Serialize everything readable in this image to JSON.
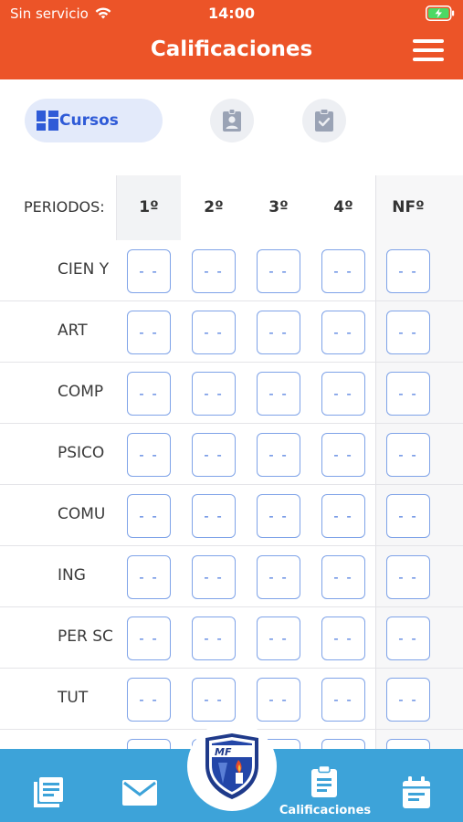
{
  "status_bar": {
    "carrier": "Sin servicio",
    "time": "14:00"
  },
  "header": {
    "title": "Calificaciones"
  },
  "segment": {
    "active_label": "Cursos"
  },
  "table": {
    "periods_label": "PERIODOS:",
    "periods": [
      "1º",
      "2º",
      "3º",
      "4º"
    ],
    "final_period": "NFº",
    "rows": [
      {
        "subject": "CIEN Y",
        "grades": [
          "- -",
          "- -",
          "- -",
          "- -"
        ],
        "final": "- -"
      },
      {
        "subject": "ART",
        "grades": [
          "- -",
          "- -",
          "- -",
          "- -"
        ],
        "final": "- -"
      },
      {
        "subject": "COMP",
        "grades": [
          "- -",
          "- -",
          "- -",
          "- -"
        ],
        "final": "- -"
      },
      {
        "subject": "PSICO",
        "grades": [
          "- -",
          "- -",
          "- -",
          "- -"
        ],
        "final": "- -"
      },
      {
        "subject": "COMU",
        "grades": [
          "- -",
          "- -",
          "- -",
          "- -"
        ],
        "final": "- -"
      },
      {
        "subject": "ING",
        "grades": [
          "- -",
          "- -",
          "- -",
          "- -"
        ],
        "final": "- -"
      },
      {
        "subject": "PER SC",
        "grades": [
          "- -",
          "- -",
          "- -",
          "- -"
        ],
        "final": "- -"
      },
      {
        "subject": "TUT",
        "grades": [
          "- -",
          "- -",
          "- -",
          "- -"
        ],
        "final": "- -"
      }
    ]
  },
  "bottom_nav": {
    "active_label": "Calificaciones",
    "logo_text": "MF",
    "icons": [
      "news-icon",
      "mail-icon",
      "school-logo",
      "clipboard-icon",
      "calendar-icon"
    ]
  },
  "colors": {
    "header": "#EC5428",
    "accent": "#2F5BD7",
    "nav": "#3DA3D9",
    "cell_border": "#7FA3E8"
  }
}
